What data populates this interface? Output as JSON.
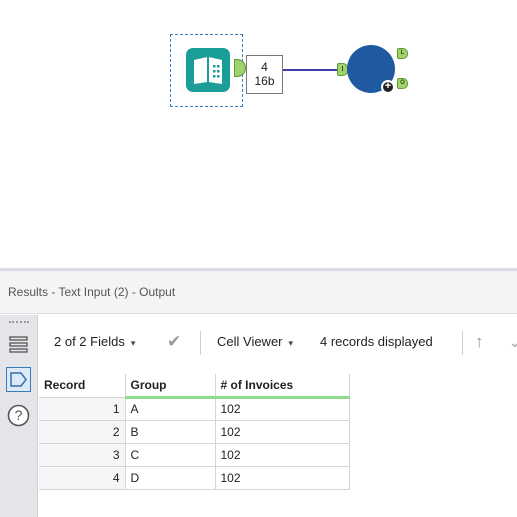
{
  "canvas": {
    "badge": {
      "records": "4",
      "size": "16b"
    },
    "anchors": {
      "input": "I",
      "lower": "L",
      "output": "O"
    },
    "plus_symbol": "+",
    "colors": {
      "tool_teal": "#1a9e97",
      "anchor_green": "#9fd36d",
      "browse_blue": "#1f5aa0",
      "connector": "#3d3fa8"
    }
  },
  "results": {
    "title": "Results - Text Input (2) - Output",
    "side_rail": {
      "icons": [
        "menu-icon",
        "tag-icon",
        "help-icon"
      ],
      "help_glyph": "?"
    },
    "toolbar": {
      "fields_label": "2 of 2 Fields",
      "cell_viewer_label": "Cell Viewer",
      "records_status": "4 records displayed",
      "caret": "▾",
      "check_glyph": "✔",
      "arrow_up_glyph": "↑",
      "arrow_next_glyph": "⌄"
    },
    "table": {
      "headers": [
        "Record",
        "Group",
        "# of Invoices"
      ],
      "rows": [
        {
          "record": "1",
          "group": "A",
          "invoices": "102"
        },
        {
          "record": "2",
          "group": "B",
          "invoices": "102"
        },
        {
          "record": "3",
          "group": "C",
          "invoices": "102"
        },
        {
          "record": "4",
          "group": "D",
          "invoices": "102"
        }
      ]
    }
  }
}
